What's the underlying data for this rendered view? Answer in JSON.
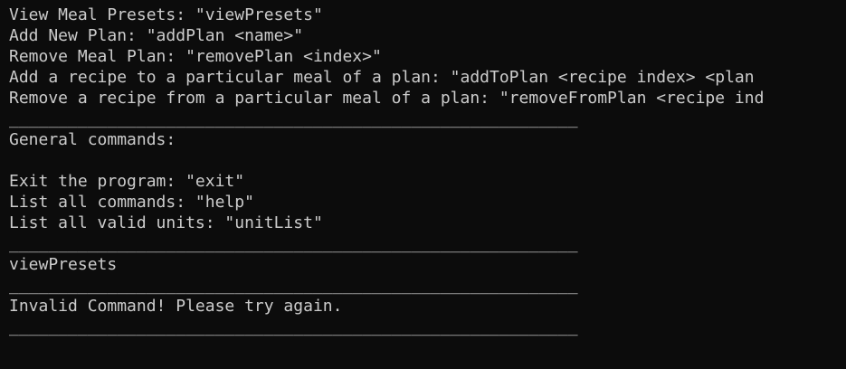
{
  "terminal": {
    "lines": [
      "View Meal Presets: \"viewPresets\"",
      "Add New Plan: \"addPlan <name>\"",
      "Remove Meal Plan: \"removePlan <index>\"",
      "Add a recipe to a particular meal of a plan: \"addToPlan <recipe index> <plan",
      "Remove a recipe from a particular meal of a plan: \"removeFromPlan <recipe ind",
      "__________________________________________________________",
      "General commands:",
      "",
      "Exit the program: \"exit\"",
      "List all commands: \"help\"",
      "List all valid units: \"unitList\"",
      "__________________________________________________________",
      "viewPresets",
      "__________________________________________________________",
      "Invalid Command! Please try again.",
      "__________________________________________________________"
    ]
  }
}
